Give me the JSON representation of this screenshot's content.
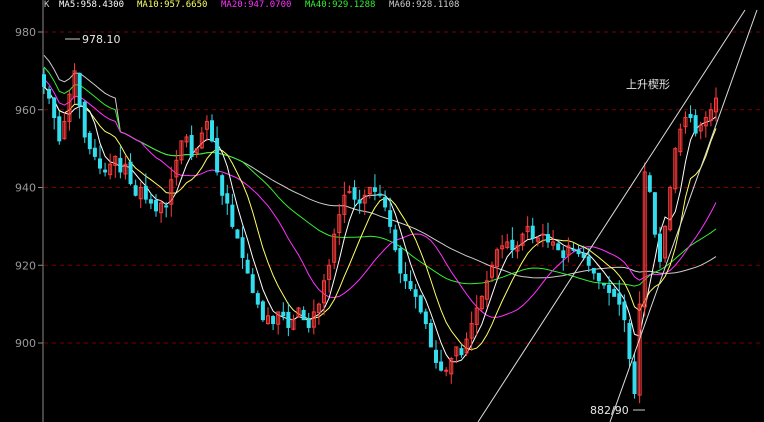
{
  "legend": {
    "prefix": "K",
    "items": [
      {
        "label": "MA5:958.4300",
        "color": "#ffffff"
      },
      {
        "label": "MA10:957.6650",
        "color": "#ffff66"
      },
      {
        "label": "MA20:947.0700",
        "color": "#ff33ff"
      },
      {
        "label": "MA40:929.1288",
        "color": "#33ee33"
      },
      {
        "label": "MA60:928.1108",
        "color": "#cccccc"
      }
    ]
  },
  "annotations": {
    "high": "978.10",
    "low": "882/90",
    "pattern": "上升楔形"
  },
  "colors": {
    "background": "#000000",
    "up_candle": "#ff3c3c",
    "down_candle": "#33ddee",
    "grid": "#7a0000",
    "axis": "#8a8a8a",
    "wedge_line": "#dddddd"
  },
  "chart_data": {
    "type": "candlestick",
    "title": "",
    "y_ticks": [
      980,
      960,
      940,
      920,
      900
    ],
    "ylim": [
      878,
      988
    ],
    "grid": "horizontal dashed",
    "close_approx": [
      966,
      963,
      958,
      952,
      957,
      964,
      970,
      961,
      953,
      950,
      948,
      945,
      944,
      946,
      948,
      944,
      946,
      941,
      938,
      940,
      937,
      936,
      934,
      936,
      935,
      942,
      947,
      952,
      953,
      948,
      950,
      954,
      957,
      952,
      944,
      938,
      936,
      930,
      927,
      922,
      918,
      913,
      910,
      906,
      907,
      905,
      908,
      907,
      904,
      906,
      909,
      906,
      904,
      908,
      910,
      916,
      920,
      928,
      933,
      938,
      939,
      937,
      936,
      938,
      940,
      939,
      938,
      935,
      930,
      924,
      918,
      916,
      914,
      912,
      908,
      905,
      899,
      895,
      893,
      893,
      896,
      899,
      897,
      901,
      905,
      909,
      912,
      916,
      920,
      924,
      925,
      926,
      924,
      925,
      928,
      930,
      927,
      927,
      928,
      926,
      926,
      924,
      922,
      925,
      924,
      923,
      922,
      920,
      918,
      916,
      915,
      913,
      912,
      910,
      906,
      896,
      887,
      910,
      944,
      939,
      928,
      921,
      930,
      940,
      950,
      955,
      958,
      958,
      954,
      956,
      958,
      960,
      963
    ],
    "moving_averages": [
      {
        "name": "MA5",
        "last": 958.43
      },
      {
        "name": "MA10",
        "last": 957.665
      },
      {
        "name": "MA20",
        "last": 947.07
      },
      {
        "name": "MA40",
        "last": 929.1288
      },
      {
        "name": "MA60",
        "last": 928.1108
      }
    ],
    "annotations": [
      {
        "text": "978.10",
        "x_index": 6,
        "y": 978.1
      },
      {
        "text": "882/90",
        "x_index": 116,
        "y": 882.9
      },
      {
        "text": "上升楔形",
        "x_index": 137,
        "y": 966
      }
    ]
  }
}
